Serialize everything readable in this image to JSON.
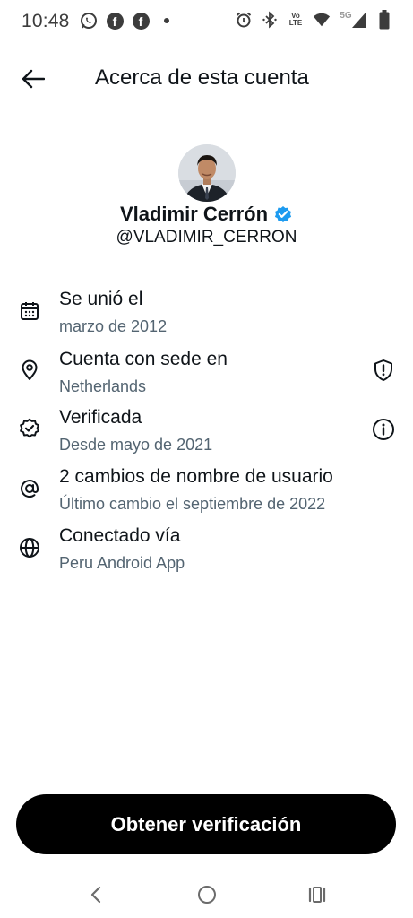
{
  "status_bar": {
    "time": "10:48",
    "network_label": "5G",
    "volte_top": "Vo",
    "volte_bottom": "LTE",
    "left_icons": [
      "whatsapp-icon",
      "facebook-icon",
      "facebook-icon",
      "notification-dot"
    ],
    "right_icons": [
      "alarm-icon",
      "bluetooth-icon",
      "volte-icon",
      "wifi-icon",
      "signal-icon",
      "battery-icon"
    ]
  },
  "header": {
    "title": "Acerca de esta cuenta"
  },
  "profile": {
    "name": "Vladimir Cerrón",
    "handle": "@VLADIMIR_CERRON",
    "verified": true,
    "verified_color": "#1d9bf0"
  },
  "info": [
    {
      "icon": "calendar-icon",
      "title": "Se unió el",
      "subtitle": "marzo de 2012"
    },
    {
      "icon": "location-pin-icon",
      "title": "Cuenta con sede en",
      "subtitle": "Netherlands",
      "action_icon": "shield-alert-icon"
    },
    {
      "icon": "verified-badge-icon",
      "title": "Verificada",
      "subtitle": "Desde mayo de 2021",
      "action_icon": "info-icon"
    },
    {
      "icon": "at-sign-icon",
      "title": "2 cambios de nombre de usuario",
      "subtitle": "Último cambio el septiembre de 2022"
    },
    {
      "icon": "globe-icon",
      "title": "Conectado vía",
      "subtitle": "Peru Android App"
    }
  ],
  "cta": {
    "label": "Obtener verificación"
  },
  "colors": {
    "text_primary": "#0f1419",
    "text_secondary": "#536471",
    "button_bg": "#000000",
    "button_text": "#ffffff",
    "verified_blue": "#1d9bf0"
  },
  "nav_bar": {
    "items": [
      "back-nav-icon",
      "home-nav-icon",
      "recents-nav-icon"
    ]
  }
}
